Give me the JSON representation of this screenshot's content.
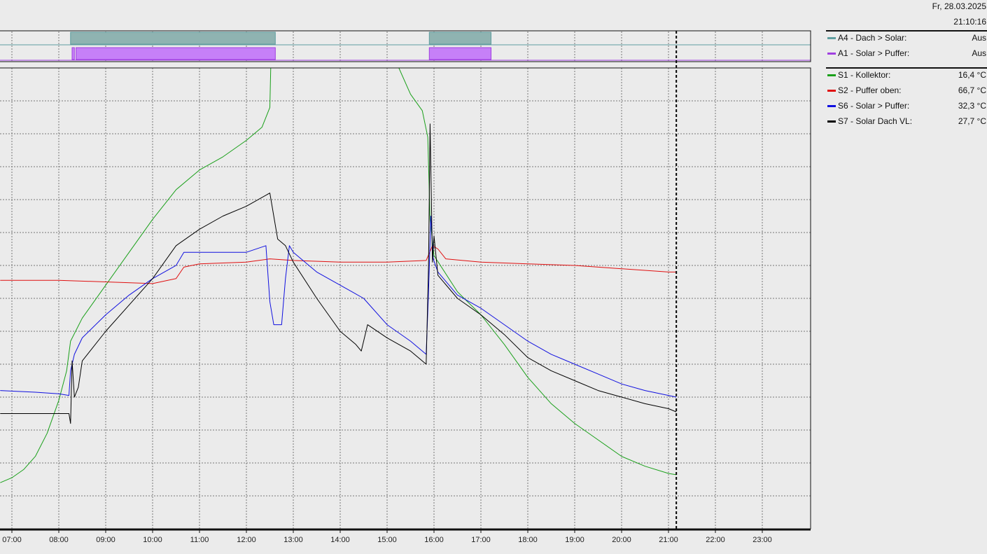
{
  "header": {
    "date": "Fr, 28.03.2025",
    "time": "21:10:16"
  },
  "legend": {
    "outputs": [
      {
        "label": "A4 - Dach > Solar:",
        "value": "Aus",
        "color": "#5f9ea0"
      },
      {
        "label": "A1 - Solar > Puffer:",
        "value": "Aus",
        "color": "#a040e0"
      }
    ],
    "sensors": [
      {
        "label": "S1 - Kollektor:",
        "value": "16,4 °C",
        "color": "#1aa01a"
      },
      {
        "label": "S2 - Puffer oben:",
        "value": "66,7 °C",
        "color": "#e01010"
      },
      {
        "label": "S6 - Solar > Puffer:",
        "value": "32,3 °C",
        "color": "#1010e0"
      },
      {
        "label": "S7 - Solar Dach VL:",
        "value": "27,7 °C",
        "color": "#000000"
      }
    ]
  },
  "chart_data": {
    "type": "line",
    "xlim": [
      "06:45",
      "24:00"
    ],
    "x_ticks": [
      "07:00",
      "08:00",
      "09:00",
      "10:00",
      "11:00",
      "12:00",
      "13:00",
      "14:00",
      "15:00",
      "16:00",
      "17:00",
      "18:00",
      "19:00",
      "20:00",
      "21:00",
      "22:00",
      "23:00"
    ],
    "current_time": "21:10",
    "ylim": [
      0,
      140
    ],
    "y_labels_shown": false,
    "grid": true,
    "legend_position": "right",
    "digital_outputs": [
      {
        "name": "A4 - Dach > Solar",
        "color": "#5f9ea0",
        "fill": "#8fb3b1",
        "on_intervals": [
          [
            "08:15",
            "12:37"
          ],
          [
            "15:54",
            "17:13"
          ]
        ]
      },
      {
        "name": "A1 - Solar > Puffer",
        "color": "#a040e0",
        "fill": "#c680f8",
        "on_intervals": [
          [
            "08:17",
            "08:20"
          ],
          [
            "08:22",
            "12:37"
          ],
          [
            "15:54",
            "17:13"
          ]
        ]
      }
    ],
    "series": [
      {
        "name": "S1 - Kollektor",
        "color": "#1aa01a",
        "points": [
          [
            "06:45",
            14
          ],
          [
            "07:00",
            15.5
          ],
          [
            "07:15",
            18
          ],
          [
            "07:30",
            22
          ],
          [
            "07:45",
            29
          ],
          [
            "08:00",
            39
          ],
          [
            "08:10",
            48
          ],
          [
            "08:15",
            57
          ],
          [
            "08:30",
            64
          ],
          [
            "09:00",
            74
          ],
          [
            "09:30",
            84
          ],
          [
            "10:00",
            94
          ],
          [
            "10:30",
            103
          ],
          [
            "11:00",
            109
          ],
          [
            "11:30",
            113
          ],
          [
            "12:00",
            118
          ],
          [
            "12:20",
            122
          ],
          [
            "12:30",
            128
          ],
          [
            "12:33",
            160
          ],
          [
            "15:05",
            160
          ],
          [
            "15:15",
            140
          ],
          [
            "15:30",
            132
          ],
          [
            "15:45",
            127
          ],
          [
            "15:52",
            119
          ],
          [
            "15:55",
            94
          ],
          [
            "16:00",
            83
          ],
          [
            "16:30",
            72
          ],
          [
            "17:00",
            65
          ],
          [
            "17:30",
            56
          ],
          [
            "18:00",
            46
          ],
          [
            "18:30",
            38
          ],
          [
            "19:00",
            32
          ],
          [
            "19:30",
            27
          ],
          [
            "20:00",
            22
          ],
          [
            "20:30",
            19
          ],
          [
            "21:00",
            16.8
          ],
          [
            "21:10",
            16.4
          ]
        ]
      },
      {
        "name": "S2 - Puffer oben",
        "color": "#e01010",
        "points": [
          [
            "06:45",
            75.5
          ],
          [
            "07:30",
            75.5
          ],
          [
            "08:00",
            75.5
          ],
          [
            "09:00",
            75
          ],
          [
            "10:00",
            74.5
          ],
          [
            "10:30",
            76
          ],
          [
            "10:40",
            79.5
          ],
          [
            "11:00",
            80.5
          ],
          [
            "12:00",
            81
          ],
          [
            "12:30",
            82
          ],
          [
            "13:00",
            81.5
          ],
          [
            "14:00",
            81
          ],
          [
            "15:00",
            81
          ],
          [
            "15:50",
            81.5
          ],
          [
            "15:58",
            86
          ],
          [
            "16:05",
            85
          ],
          [
            "16:15",
            82
          ],
          [
            "17:00",
            81
          ],
          [
            "18:00",
            80.5
          ],
          [
            "19:00",
            80
          ],
          [
            "20:00",
            79
          ],
          [
            "21:00",
            78
          ],
          [
            "21:10",
            78
          ]
        ]
      },
      {
        "name": "S6 - Solar > Puffer",
        "color": "#1010e0",
        "points": [
          [
            "06:45",
            42
          ],
          [
            "07:30",
            41.5
          ],
          [
            "08:00",
            41
          ],
          [
            "08:13",
            40.5
          ],
          [
            "08:15",
            48
          ],
          [
            "08:20",
            53
          ],
          [
            "08:30",
            58
          ],
          [
            "09:00",
            65
          ],
          [
            "09:30",
            71
          ],
          [
            "10:00",
            76
          ],
          [
            "10:30",
            80
          ],
          [
            "10:40",
            84
          ],
          [
            "11:00",
            84
          ],
          [
            "11:30",
            84
          ],
          [
            "12:00",
            84
          ],
          [
            "12:25",
            86
          ],
          [
            "12:30",
            69
          ],
          [
            "12:35",
            62
          ],
          [
            "12:45",
            62
          ],
          [
            "12:50",
            76
          ],
          [
            "12:55",
            86
          ],
          [
            "13:00",
            84
          ],
          [
            "13:30",
            78
          ],
          [
            "14:00",
            74
          ],
          [
            "14:30",
            70
          ],
          [
            "15:00",
            62
          ],
          [
            "15:30",
            57
          ],
          [
            "15:50",
            53
          ],
          [
            "15:53",
            72
          ],
          [
            "15:56",
            95
          ],
          [
            "15:59",
            82
          ],
          [
            "16:05",
            78
          ],
          [
            "16:30",
            71
          ],
          [
            "17:00",
            67
          ],
          [
            "17:30",
            62
          ],
          [
            "18:00",
            57
          ],
          [
            "18:30",
            53
          ],
          [
            "19:00",
            50
          ],
          [
            "19:30",
            47
          ],
          [
            "20:00",
            44
          ],
          [
            "20:30",
            42
          ],
          [
            "21:00",
            40.5
          ],
          [
            "21:10",
            40
          ]
        ]
      },
      {
        "name": "S7 - Solar Dach VL",
        "color": "#000000",
        "points": [
          [
            "06:45",
            35
          ],
          [
            "07:30",
            35
          ],
          [
            "08:00",
            35
          ],
          [
            "08:13",
            35
          ],
          [
            "08:15",
            32
          ],
          [
            "08:17",
            51
          ],
          [
            "08:20",
            40
          ],
          [
            "08:25",
            43
          ],
          [
            "08:30",
            51
          ],
          [
            "09:00",
            60
          ],
          [
            "09:30",
            68
          ],
          [
            "10:00",
            76
          ],
          [
            "10:30",
            86
          ],
          [
            "11:00",
            91
          ],
          [
            "11:30",
            95
          ],
          [
            "12:00",
            98
          ],
          [
            "12:30",
            102
          ],
          [
            "12:35",
            95
          ],
          [
            "12:40",
            88
          ],
          [
            "12:50",
            86
          ],
          [
            "13:00",
            81
          ],
          [
            "13:30",
            70
          ],
          [
            "14:00",
            60
          ],
          [
            "14:20",
            56
          ],
          [
            "14:27",
            54
          ],
          [
            "14:35",
            62
          ],
          [
            "15:00",
            58
          ],
          [
            "15:30",
            54
          ],
          [
            "15:50",
            50
          ],
          [
            "15:53",
            80
          ],
          [
            "15:55",
            123
          ],
          [
            "15:58",
            81
          ],
          [
            "16:00",
            89
          ],
          [
            "16:05",
            77
          ],
          [
            "16:30",
            70
          ],
          [
            "17:00",
            65
          ],
          [
            "17:30",
            59
          ],
          [
            "18:00",
            52
          ],
          [
            "18:30",
            48
          ],
          [
            "19:00",
            45
          ],
          [
            "19:30",
            42
          ],
          [
            "20:00",
            40
          ],
          [
            "20:30",
            38
          ],
          [
            "21:00",
            36.5
          ],
          [
            "21:10",
            35.5
          ]
        ]
      }
    ]
  }
}
